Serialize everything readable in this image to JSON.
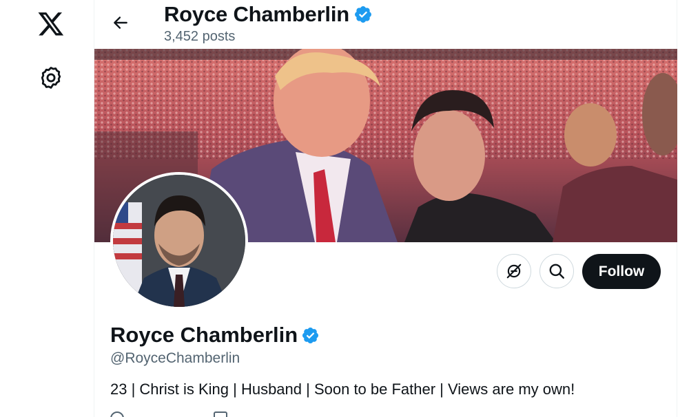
{
  "nav": {
    "logo_icon": "x-logo-icon",
    "settings_icon": "gear-icon"
  },
  "header": {
    "back_icon": "arrow-left-icon",
    "name": "Royce Chamberlin",
    "verified_icon": "verified-badge-icon",
    "posts_count": "3,452 posts"
  },
  "profile": {
    "banner_image": "photo-two-men-arena-crowd",
    "avatar_image": "portrait-man-suit-flag",
    "display_name": "Royce Chamberlin",
    "handle": "@RoyceChamberlin",
    "bio": "23 | Christ is King | Husband | Soon to be Father | Views are my own!"
  },
  "actions": {
    "subscribe_icon": "subscribe-icon",
    "search_icon": "search-icon",
    "follow_label": "Follow"
  },
  "colors": {
    "verified": "#1d9bf0",
    "text_primary": "#0f1419",
    "text_secondary": "#536471",
    "follow_bg": "#0f1419",
    "border": "#cfd9de"
  }
}
